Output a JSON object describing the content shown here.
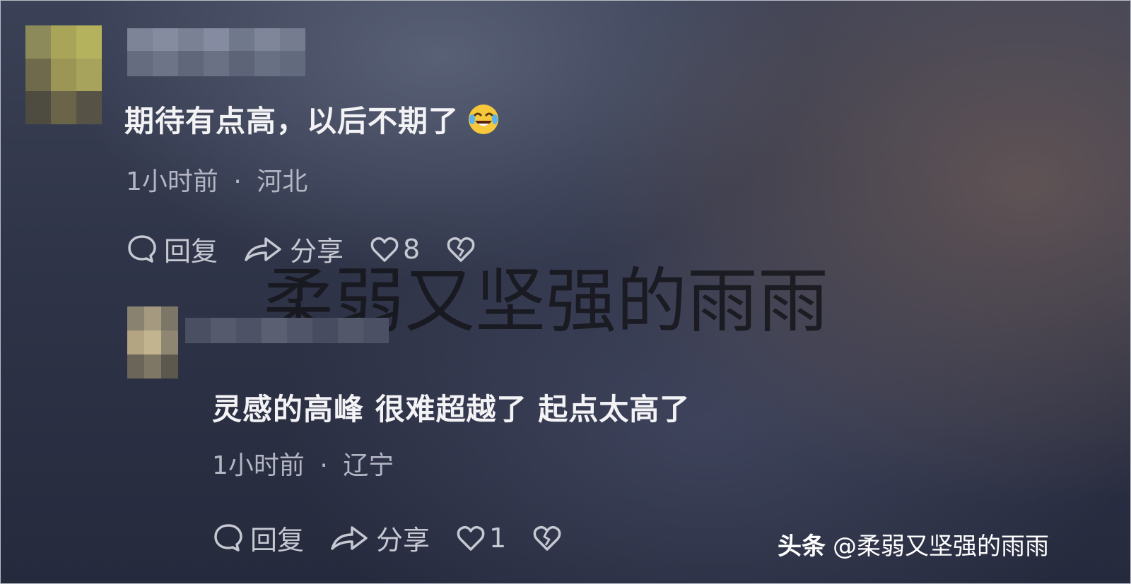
{
  "comments": [
    {
      "text": "期待有点高，以后不期了",
      "emoji": "tears-of-joy-emoji",
      "time": "1小时前",
      "location": "河北",
      "actions": {
        "reply_label": "回复",
        "share_label": "分享",
        "like_count": "8"
      }
    },
    {
      "text": "灵感的高峰 很难超越了 起点太高了",
      "time": "1小时前",
      "location": "辽宁",
      "actions": {
        "reply_label": "回复",
        "share_label": "分享",
        "like_count": "1"
      }
    }
  ],
  "separator": "·",
  "watermarks": {
    "center": "柔弱又坚强的雨雨",
    "corner_brand": "头条",
    "corner_handle": "@柔弱又坚强的雨雨"
  },
  "colors": {
    "background_dark": "#262a3d",
    "text_primary": "#f3f3f6",
    "text_secondary": "#b3b6c3"
  }
}
